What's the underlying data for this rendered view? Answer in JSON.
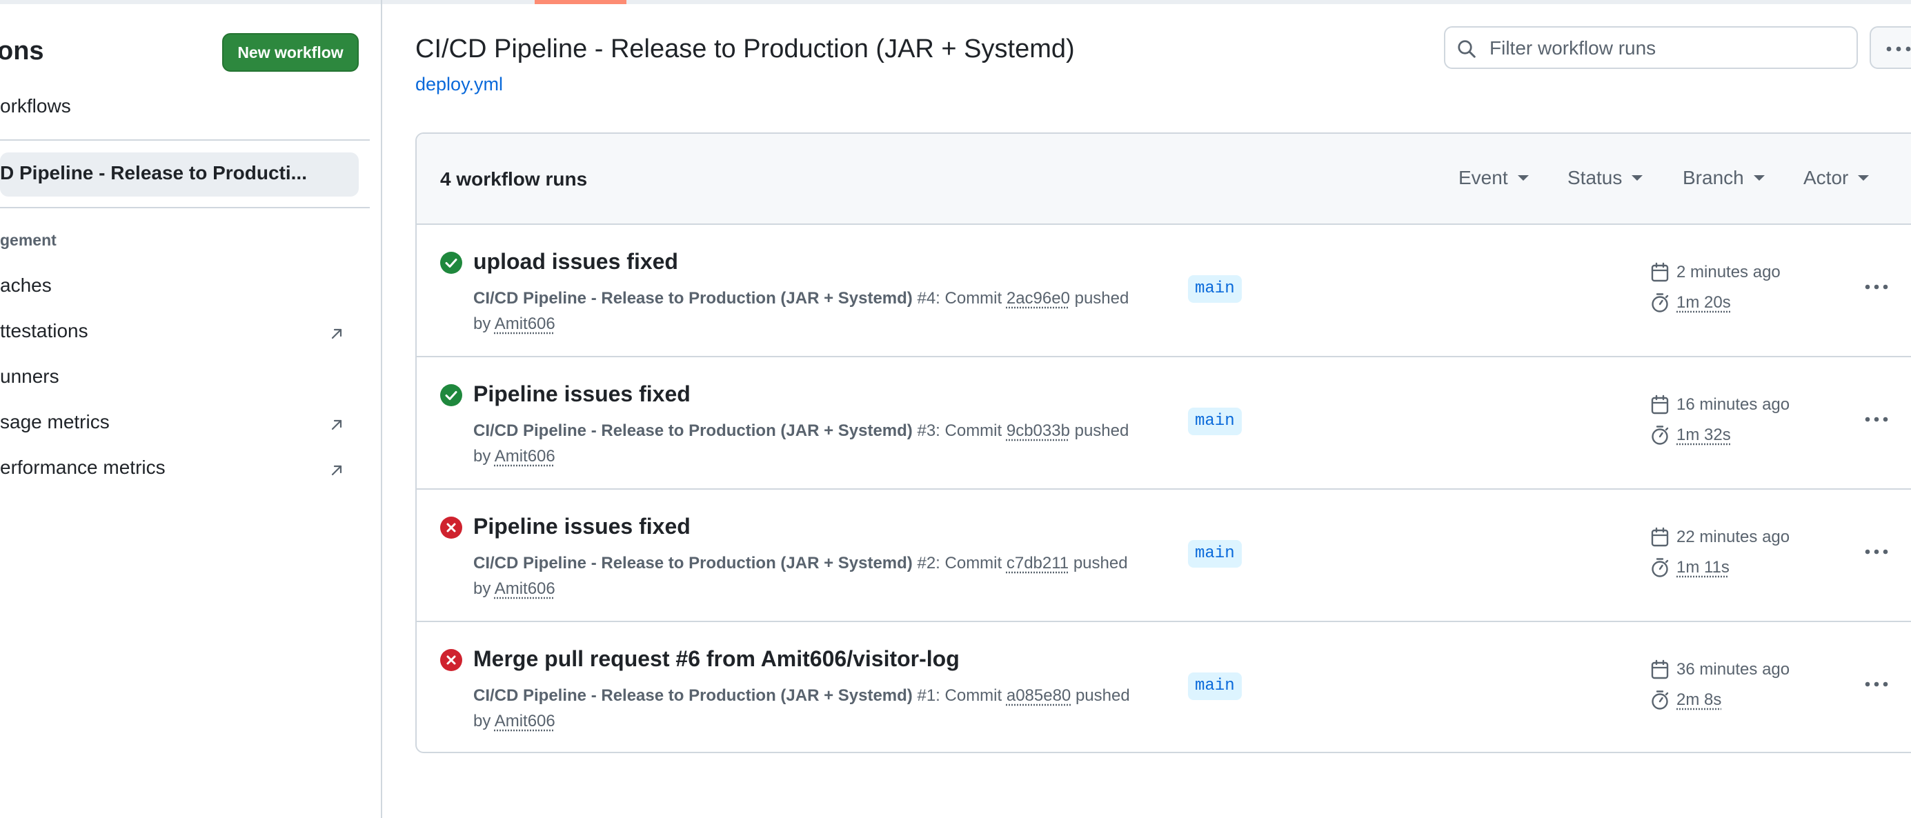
{
  "sidebar": {
    "title": "ons",
    "new_workflow_label": "New workflow",
    "all_workflows_label": "orkflows",
    "active_workflow": "D Pipeline - Release to Producti...",
    "management_heading": "gement",
    "items": [
      {
        "label": "aches",
        "external": false
      },
      {
        "label": "ttestations",
        "external": true
      },
      {
        "label": "unners",
        "external": false
      },
      {
        "label": "sage metrics",
        "external": true
      },
      {
        "label": "erformance metrics",
        "external": true
      }
    ]
  },
  "header": {
    "title": "CI/CD Pipeline - Release to Production (JAR + Systemd)",
    "file": "deploy.yml",
    "search_placeholder": "Filter workflow runs"
  },
  "runs_list": {
    "count_label": "4 workflow runs",
    "filters": [
      "Event",
      "Status",
      "Branch",
      "Actor"
    ],
    "runs": [
      {
        "status": "success",
        "title": "upload issues fixed",
        "workflow": "CI/CD Pipeline - Release to Production (JAR + Systemd)",
        "number": "#4",
        "commit_prefix": ": Commit ",
        "commit": "2ac96e0",
        "pushed_text": " pushed",
        "by_text": "by ",
        "actor": "Amit606",
        "branch": "main",
        "time": "2 minutes ago",
        "duration": "1m 20s"
      },
      {
        "status": "success",
        "title": "Pipeline issues fixed",
        "workflow": "CI/CD Pipeline - Release to Production (JAR + Systemd)",
        "number": "#3",
        "commit_prefix": ": Commit ",
        "commit": "9cb033b",
        "pushed_text": " pushed",
        "by_text": "by ",
        "actor": "Amit606",
        "branch": "main",
        "time": "16 minutes ago",
        "duration": "1m 32s"
      },
      {
        "status": "failure",
        "title": "Pipeline issues fixed",
        "workflow": "CI/CD Pipeline - Release to Production (JAR + Systemd)",
        "number": "#2",
        "commit_prefix": ": Commit ",
        "commit": "c7db211",
        "pushed_text": " pushed",
        "by_text": "by ",
        "actor": "Amit606",
        "branch": "main",
        "time": "22 minutes ago",
        "duration": "1m 11s"
      },
      {
        "status": "failure",
        "title": "Merge pull request #6 from Amit606/visitor-log",
        "workflow": "CI/CD Pipeline - Release to Production (JAR + Systemd)",
        "number": "#1",
        "commit_prefix": ": Commit ",
        "commit": "a085e80",
        "pushed_text": " pushed",
        "by_text": "by ",
        "actor": "Amit606",
        "branch": "main",
        "time": "36 minutes ago",
        "duration": "2m 8s"
      }
    ]
  },
  "colors": {
    "success": "#1f883d",
    "failure": "#cf222e",
    "accent": "#0969da",
    "primary_button": "#2d883e"
  }
}
